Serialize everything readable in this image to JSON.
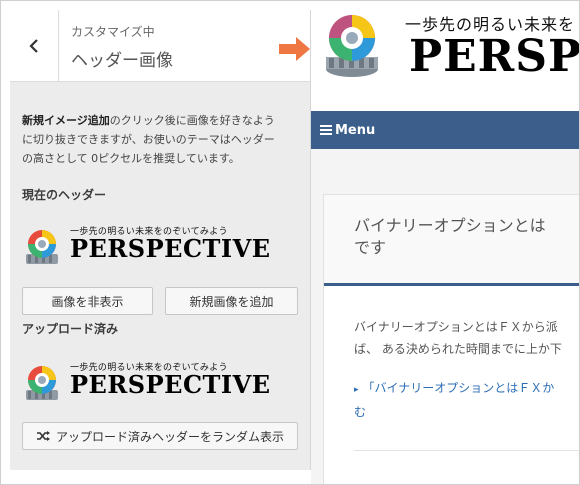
{
  "panel": {
    "subtitle": "カスタマイズ中",
    "title": "ヘッダー画像",
    "description_bold": "新規イメージ追加",
    "description_rest_1": "のクリック後に画像を好きなよう",
    "description_rest_2": "に切り抜きできますが、お使いのテーマはヘッダー",
    "description_rest_3": "の高さとして 0ピクセルを推奨しています。",
    "current_header_label": "現在のヘッダー",
    "hide_button": "画像を非表示",
    "add_button": "新規画像を追加",
    "uploaded_label": "アップロード済み",
    "random_button": "アップロード済みヘッダーをランダム表示"
  },
  "logo": {
    "tagline": "一歩先の明るい未来をのぞいてみよう",
    "wordmark": "PERSPECTIVE"
  },
  "preview": {
    "site_tagline": "一歩先の明るい未来を",
    "site_wordmark": "PERSPE",
    "menu_label": "Menu",
    "article_title": "バイナリーオプションとは\nです",
    "article_text": "バイナリーオプションとはＦＸから派\nば、 ある決められた時間までに上か下",
    "article_link": "「バイナリーオプションとはＦＸか\nむ"
  },
  "colors": {
    "menu_bar": "#3b5f8a",
    "arrow": "#ee7744",
    "link": "#2d6db5",
    "panel_bg": "#ececec"
  },
  "icons": {
    "back": "chevron-left-icon",
    "shuffle": "shuffle-icon",
    "menu": "hamburger-icon",
    "pointer_arrow": "arrow-right-icon",
    "logo_gear": "gear-logo-icon"
  }
}
